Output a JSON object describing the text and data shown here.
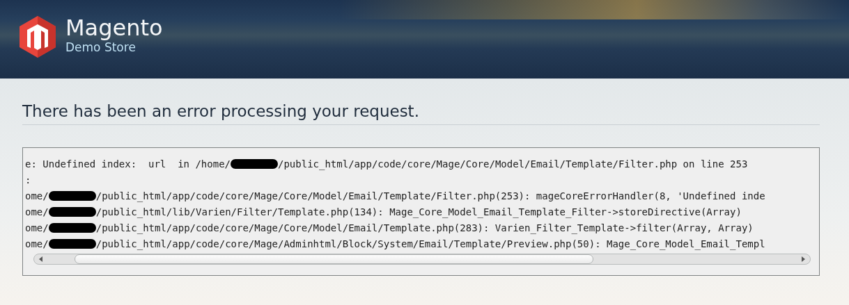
{
  "header": {
    "brand": "Magento",
    "tagline": "Demo Store"
  },
  "error": {
    "title": "There has been an error processing your request.",
    "trace": [
      {
        "before": "e: Undefined index:  url  in /home/",
        "redacted": true,
        "after": "/public_html/app/code/core/Mage/Core/Model/Email/Template/Filter.php on line 253"
      },
      {
        "before": ":",
        "redacted": false
      },
      {
        "before": "ome/",
        "redacted": true,
        "after": "/public_html/app/code/core/Mage/Core/Model/Email/Template/Filter.php(253): mageCoreErrorHandler(8, 'Undefined inde"
      },
      {
        "before": "ome/",
        "redacted": true,
        "after": "/public_html/lib/Varien/Filter/Template.php(134): Mage_Core_Model_Email_Template_Filter->storeDirective(Array)"
      },
      {
        "before": "ome/",
        "redacted": true,
        "after": "/public_html/app/code/core/Mage/Core/Model/Email/Template.php(283): Varien_Filter_Template->filter(Array, Array)"
      },
      {
        "before": "ome/",
        "redacted": true,
        "after": "/public_html/app/code/core/Mage/Adminhtml/Block/System/Email/Template/Preview.php(50): Mage_Core_Model_Email_Templ"
      }
    ]
  }
}
